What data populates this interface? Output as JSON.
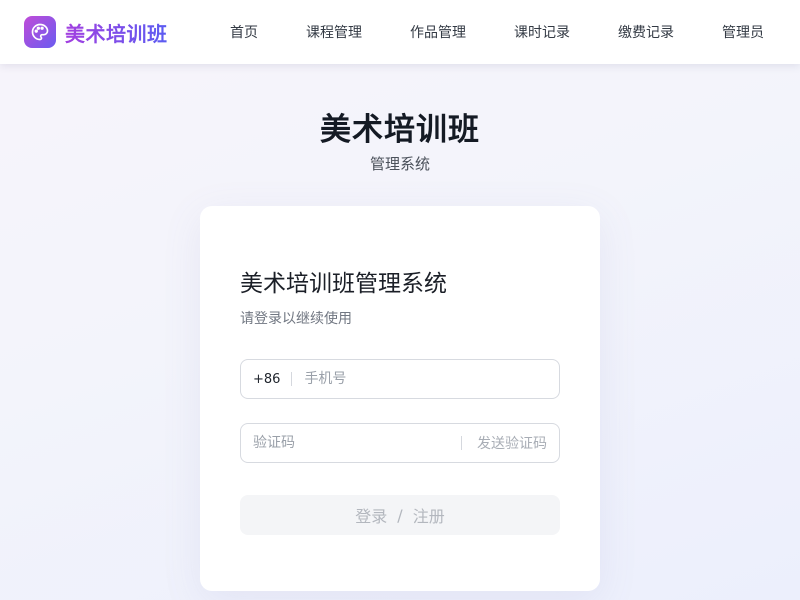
{
  "navbar": {
    "brand_icon": "palette-icon",
    "brand_name": "美术培训班",
    "items": [
      {
        "label": "首页"
      },
      {
        "label": "课程管理"
      },
      {
        "label": "作品管理"
      },
      {
        "label": "课时记录"
      },
      {
        "label": "缴费记录"
      },
      {
        "label": "管理员"
      }
    ]
  },
  "hero": {
    "title": "美术培训班",
    "subtitle": "管理系统"
  },
  "login_card": {
    "title": "美术培训班管理系统",
    "subtitle": "请登录以继续使用",
    "phone": {
      "country_code": "+86",
      "value": "",
      "placeholder": "手机号"
    },
    "code": {
      "value": "",
      "placeholder": "验证码",
      "send_label": "发送验证码"
    },
    "submit": {
      "login_label": "登录",
      "separator": "/",
      "register_label": "注册"
    }
  },
  "colors": {
    "brand_gradient_start": "#c04bd8",
    "brand_gradient_end": "#6a5cf0",
    "page_background": "#f3f4fb",
    "disabled_button_bg": "#f4f5f7",
    "disabled_button_text": "#b3b7be"
  }
}
